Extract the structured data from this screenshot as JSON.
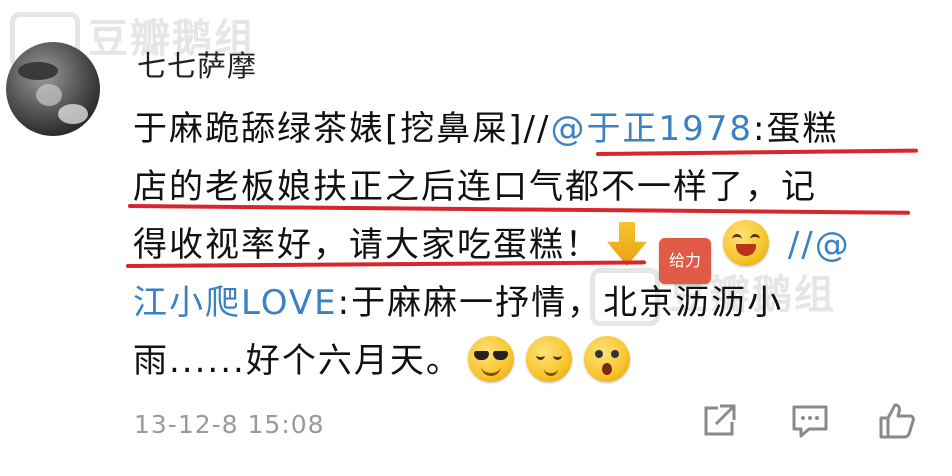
{
  "watermark": {
    "text": "豆瓣鹅组"
  },
  "post": {
    "username": "七七萨摩",
    "lines": [
      {
        "segments": [
          {
            "text": "于麻跪舔绿茶婊[挖鼻屎]//",
            "kind": "text"
          },
          {
            "text": "@于正1978",
            "kind": "mention"
          },
          {
            "text": ":蛋糕",
            "kind": "text"
          }
        ]
      },
      {
        "segments": [
          {
            "text": "店的老板娘扶正之后连口气都不一样了，记",
            "kind": "text"
          }
        ]
      },
      {
        "segments": [
          {
            "text": "得收视率好，请大家吃蛋糕！",
            "kind": "text"
          }
        ]
      },
      {
        "segments": [
          {
            "text": ":于麻麻一抒情，北京沥沥小",
            "kind": "text"
          }
        ]
      },
      {
        "segments": [
          {
            "text": "雨......好个六月天。",
            "kind": "text"
          }
        ]
      }
    ],
    "line3_tail": "//@",
    "line4_mention": "江小爬LOVE",
    "sticker_text": "给力",
    "emojis_line3": [
      "down-arrow-icon",
      "geili-sticker-icon",
      "laugh-emoji-icon"
    ],
    "emojis_line5": [
      "cool-sunglasses-emoji-icon",
      "cheek-emoji-icon",
      "shocked-emoji-icon"
    ],
    "timestamp": "13-12-8 15:08"
  },
  "actions": [
    "share-icon",
    "comment-icon",
    "like-icon"
  ],
  "colors": {
    "mention": "#3b82c4",
    "underline": "#d8262c",
    "meta": "#9a9a9a"
  }
}
